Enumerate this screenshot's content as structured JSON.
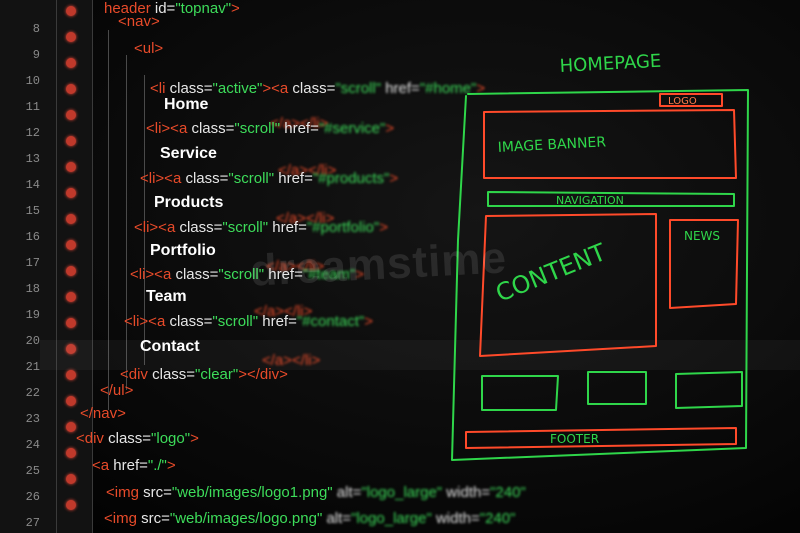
{
  "gutter": {
    "line_numbers": [
      "8",
      "9",
      "10",
      "11",
      "12",
      "13",
      "14",
      "15",
      "16",
      "17",
      "18",
      "19",
      "20",
      "21",
      "22",
      "23",
      "24",
      "25",
      "26",
      "27"
    ]
  },
  "code": {
    "line_header": {
      "tag_open": "header",
      "attr": " id=",
      "val": "\"topnav\"",
      "tag_close": ">"
    },
    "line_nav": "<nav>",
    "line_ul": "<ul>",
    "line_li_active": {
      "tag_open": "<li",
      "attr": " class=",
      "val": "\"active\"",
      "tag_close": "><a",
      "attr2": " class=",
      "val2": "\"scroll\"",
      "attr3": " href=",
      "val3": "\"#home\"",
      "end": ">"
    },
    "home": "Home",
    "close_a_li_1": "</a></li>",
    "li_scroll_1": {
      "tag_open": "<li><a",
      "attr": " class=",
      "val": "\"scroll\"",
      "attr2": " href=",
      "val2": "\"#service\"",
      "end": ">"
    },
    "service": "Service",
    "close_a_li_2": "</a></li>",
    "li_scroll_2": {
      "tag_open": "<li><a",
      "attr": " class=",
      "val": "\"scroll\"",
      "attr2": " href=",
      "val2": "\"#products\"",
      "end": ">"
    },
    "products": "Products",
    "close_a_li_3": "</a></li>",
    "li_scroll_3": {
      "tag_open": "<li><a",
      "attr": " class=",
      "val": "\"scroll\"",
      "attr2": " href=",
      "val2": "\"#portfolio\"",
      "end": ">"
    },
    "portfolio": "Portfolio",
    "close_a_li_4": "</a></li>",
    "li_scroll_4": {
      "tag_open": "<li><a",
      "attr": " class=",
      "val": "\"scroll\"",
      "attr2": " href=",
      "val2": "\"#team\"",
      "end": ">"
    },
    "team": "Team",
    "close_a_li_5": "</a></li>",
    "li_scroll_5": {
      "tag_open": "<li><a",
      "attr": " class=",
      "val": "\"scroll\"",
      "attr2": " href=",
      "val2": "\"#contact\"",
      "end": ">"
    },
    "contact": "Contact",
    "div_clear": {
      "tag_open": "<div",
      "attr": " class=",
      "val": "\"clear\"",
      "tag_close": "></div>"
    },
    "close_ul": "</ul>",
    "close_nav": "</nav>",
    "div_logo": {
      "tag_open": "<div",
      "attr": " class=",
      "val": "\"logo\"",
      "tag_close": ">"
    },
    "a_href": {
      "tag_open": "<a",
      "attr": " href=",
      "val": "\"./\"",
      "tag_close": ">"
    },
    "img_1": {
      "tag_open": "<img",
      "attr": " src=",
      "val": "\"web/images/logo1.png\"",
      "attr2": " alt=",
      "val2": "\"logo_large\"",
      "attr3": " width=",
      "val3": "\"240\""
    },
    "img_2": {
      "tag_open": "<img",
      "attr": " src=",
      "val": "\"web/images/logo.png\"",
      "attr2": " alt=",
      "val2": "\"logo_large\"",
      "attr3": " width=",
      "val3": "\"240\""
    }
  },
  "sketch": {
    "title": "HOMEPAGE",
    "logo": "LOGO",
    "banner": "IMAGE BANNER",
    "navigation": "NAVIGATION",
    "content": "CONTENT",
    "news": "NEWS",
    "footer": "FOOTER",
    "colors": {
      "green": "#2fd64a",
      "red": "#ff4a2a"
    }
  },
  "watermark": "dreamstime"
}
